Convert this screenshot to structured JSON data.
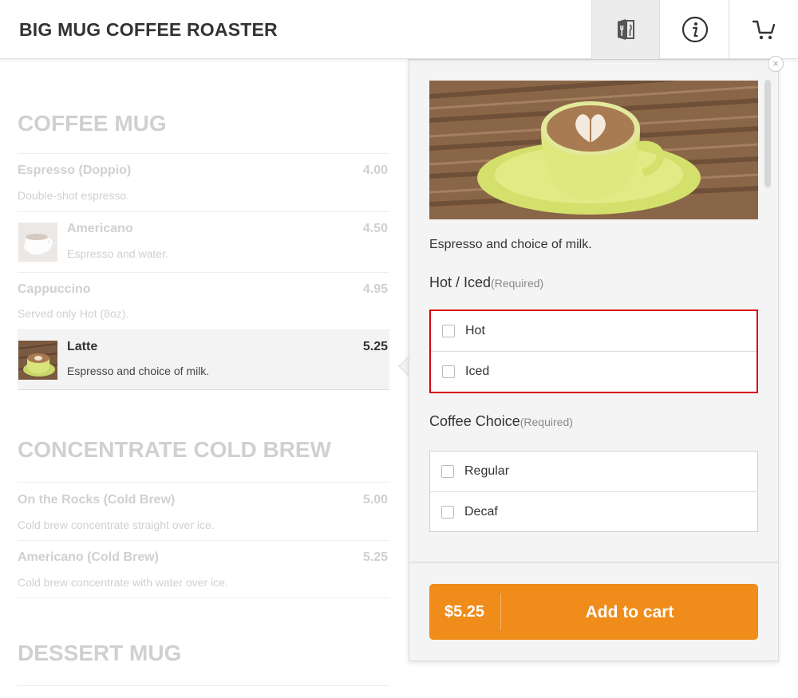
{
  "header": {
    "brand": "BIG MUG COFFEE ROASTER",
    "icons": [
      "menu-icon",
      "info-icon",
      "cart-icon"
    ]
  },
  "menu": {
    "sections": [
      {
        "title": "COFFEE MUG",
        "items": [
          {
            "name": "Espresso (Doppio)",
            "description": "Double-shot espresso.",
            "price": "4.00"
          },
          {
            "name": "Americano",
            "description": "Espresso and water.",
            "price": "4.50"
          },
          {
            "name": "Cappuccino",
            "description": "Served only Hot (8oz).",
            "price": "4.95"
          },
          {
            "name": "Latte",
            "description": "Espresso and choice of milk.",
            "price": "5.25"
          }
        ]
      },
      {
        "title": "CONCENTRATE COLD BREW",
        "items": [
          {
            "name": "On the Rocks (Cold Brew)",
            "description": "Cold brew concentrate straight over ice.",
            "price": "5.00"
          },
          {
            "name": "Americano (Cold Brew)",
            "description": "Cold brew concentrate with water over ice.",
            "price": "5.25"
          }
        ]
      },
      {
        "title": "DESSERT MUG",
        "items": []
      }
    ]
  },
  "panel": {
    "close_label": "×",
    "description": "Espresso and choice of milk.",
    "groups": [
      {
        "title": "Hot / Iced",
        "required": "(Required)",
        "options": [
          "Hot",
          "Iced"
        ]
      },
      {
        "title": "Coffee Choice",
        "required": "(Required)",
        "options": [
          "Regular",
          "Decaf"
        ]
      }
    ],
    "add_to_cart": {
      "price": "$5.25",
      "label": "Add to cart"
    }
  },
  "colors": {
    "accent": "#ef8c1a",
    "highlight_border": "#d9000d"
  }
}
